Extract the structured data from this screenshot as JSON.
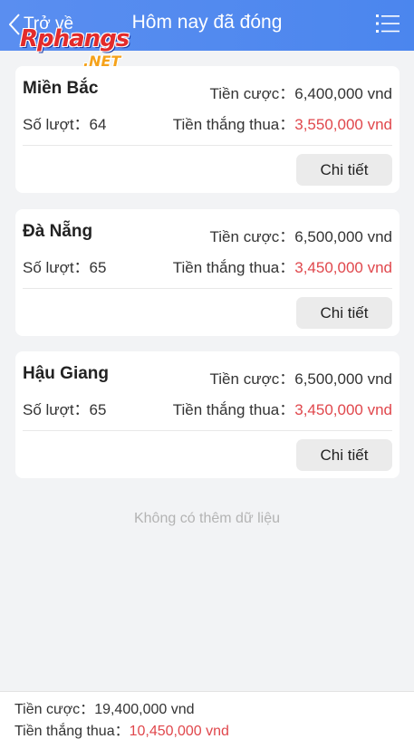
{
  "header": {
    "back_label": "Trở về",
    "title": "Hôm nay đã đóng",
    "menu_icon": "list-menu-icon",
    "back_icon": "chevron-left-icon"
  },
  "watermark": {
    "main": "Rphangs",
    "sub": ".NET"
  },
  "labels": {
    "bet": "Tiền cược：",
    "turns": "Số lượt：",
    "winloss": "Tiền thắng thua：",
    "detail_button": "Chi tiết"
  },
  "cards": [
    {
      "name": "Miền Bắc",
      "bet": "6,400,000 vnd",
      "turns": "64",
      "winloss": "3,550,000 vnd"
    },
    {
      "name": "Đà Nẵng",
      "bet": "6,500,000 vnd",
      "turns": "65",
      "winloss": "3,450,000 vnd"
    },
    {
      "name": "Hậu Giang",
      "bet": "6,500,000 vnd",
      "turns": "65",
      "winloss": "3,450,000 vnd"
    }
  ],
  "no_more_text": "Không có thêm dữ liệu",
  "footer": {
    "bet_label": "Tiền cược：",
    "bet_total": "19,400,000 vnd",
    "winloss_label": "Tiền thắng thua：",
    "winloss_total": "10,450,000 vnd"
  },
  "colors": {
    "header": "#4b86ee",
    "loss": "#e0474c",
    "background": "#f2f3f5"
  }
}
